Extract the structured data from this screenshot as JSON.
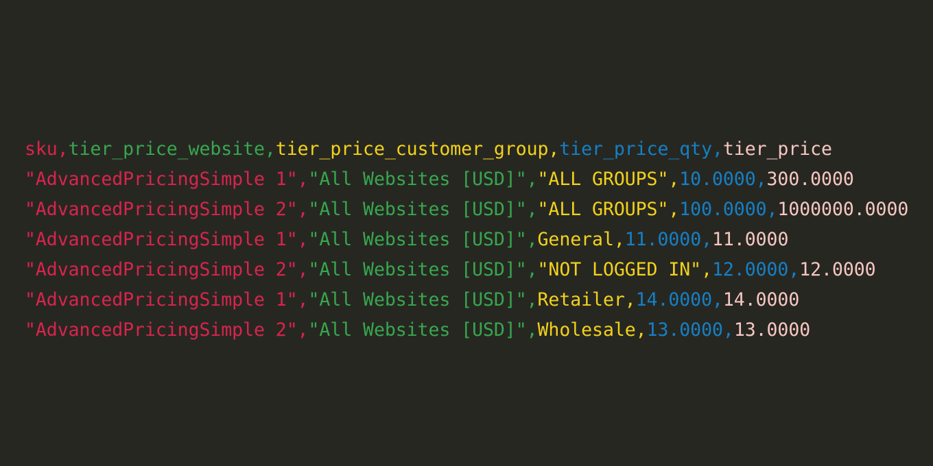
{
  "colors": {
    "background": "#272722",
    "sku": "#d9244c",
    "website": "#36a84e",
    "customer_group": "#f2d21b",
    "qty": "#1580c5",
    "price": "#f7c7c2"
  },
  "csv": {
    "header": {
      "sku": "sku,",
      "website": "tier_price_website,",
      "customer_group": "tier_price_customer_group,",
      "qty": "tier_price_qty,",
      "price": "tier_price"
    },
    "rows": [
      {
        "sku": "\"AdvancedPricingSimple 1\",",
        "website": "\"All Websites [USD]\",",
        "customer_group": "\"ALL GROUPS\",",
        "qty": "10.0000,",
        "price": "300.0000"
      },
      {
        "sku": "\"AdvancedPricingSimple 2\",",
        "website": "\"All Websites [USD]\",",
        "customer_group": "\"ALL GROUPS\",",
        "qty": "100.0000,",
        "price": "1000000.0000"
      },
      {
        "sku": "\"AdvancedPricingSimple 1\",",
        "website": "\"All Websites [USD]\",",
        "customer_group": "General,",
        "qty": "11.0000,",
        "price": "11.0000"
      },
      {
        "sku": "\"AdvancedPricingSimple 2\",",
        "website": "\"All Websites [USD]\",",
        "customer_group": "\"NOT LOGGED IN\",",
        "qty": "12.0000,",
        "price": "12.0000"
      },
      {
        "sku": "\"AdvancedPricingSimple 1\",",
        "website": "\"All Websites [USD]\",",
        "customer_group": "Retailer,",
        "qty": "14.0000,",
        "price": "14.0000"
      },
      {
        "sku": "\"AdvancedPricingSimple 2\",",
        "website": "\"All Websites [USD]\",",
        "customer_group": "Wholesale,",
        "qty": "13.0000,",
        "price": "13.0000"
      }
    ]
  }
}
